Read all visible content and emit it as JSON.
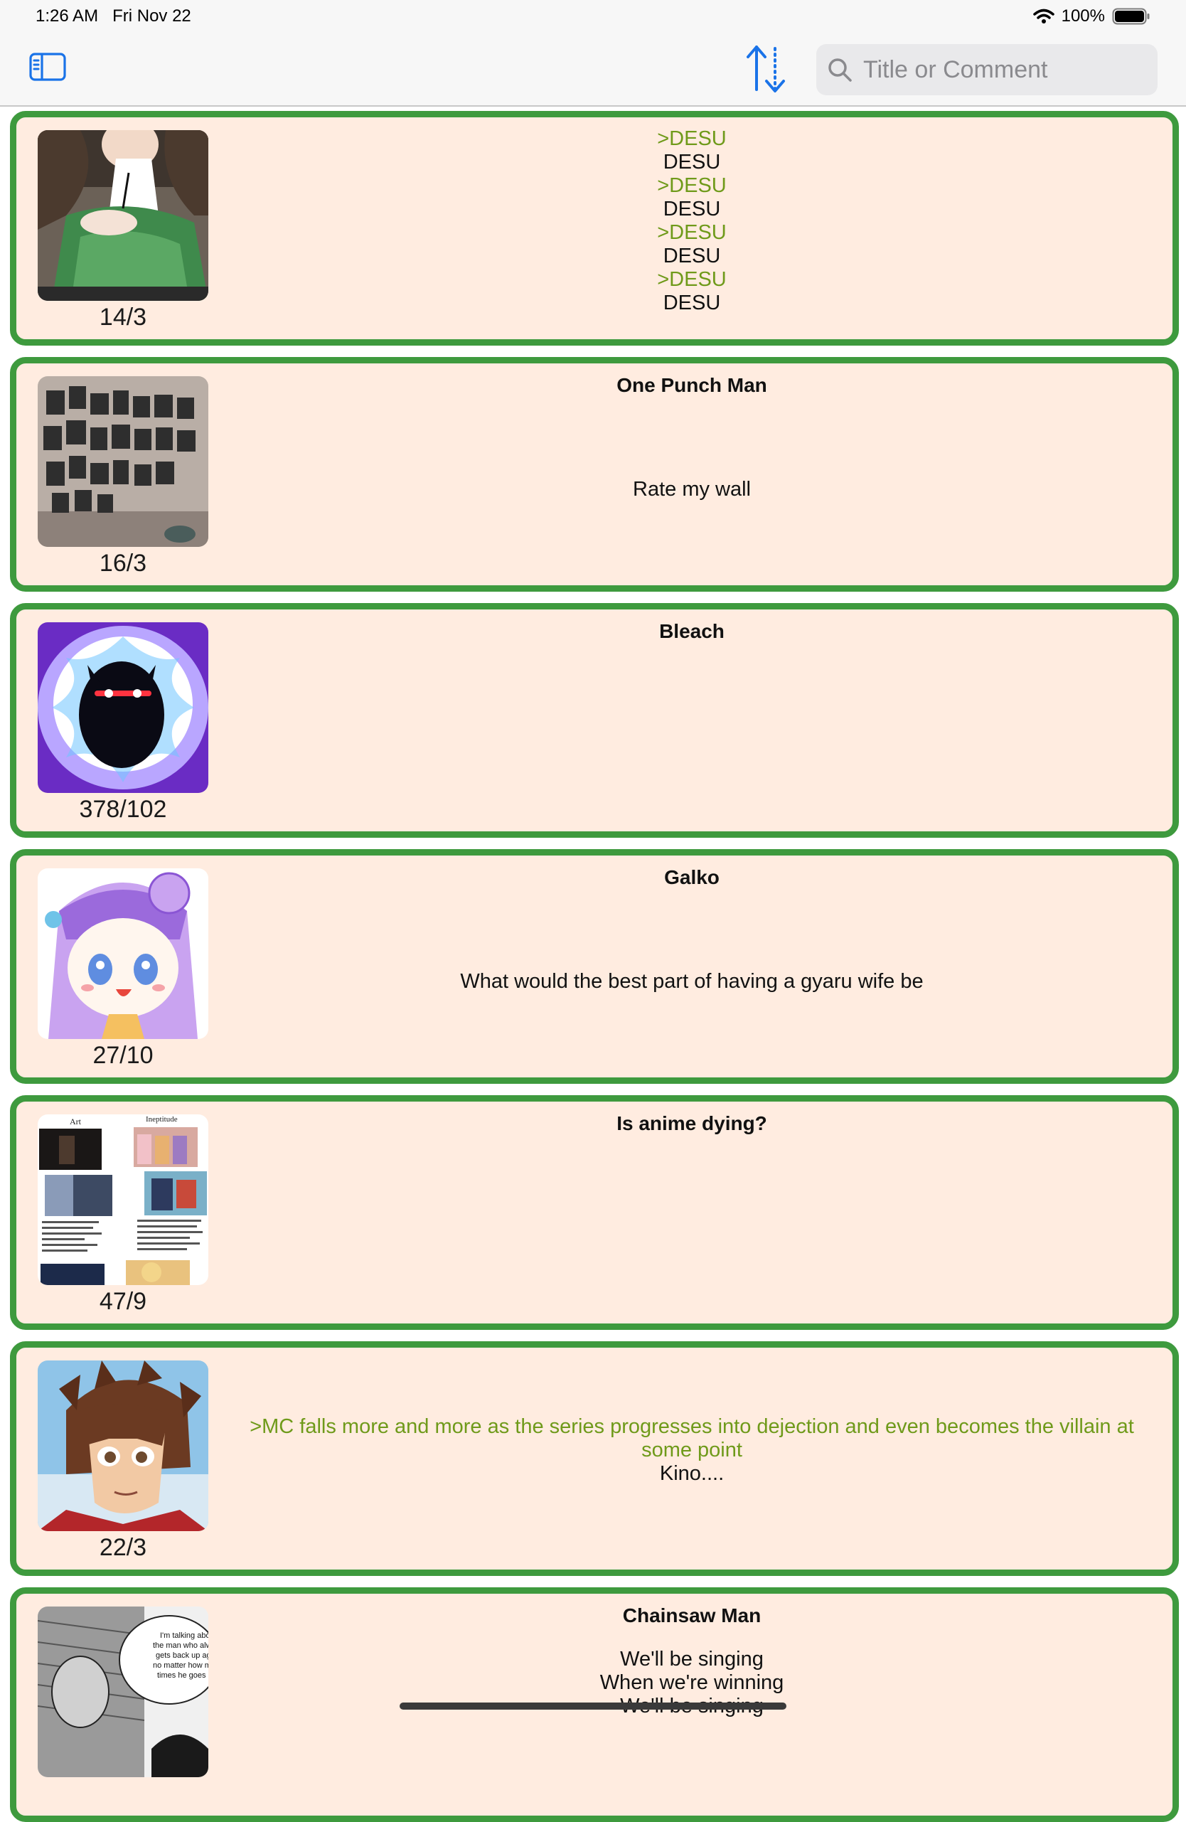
{
  "status": {
    "time": "1:26 AM",
    "date": "Fri Nov 22",
    "battery": "100%"
  },
  "search": {
    "placeholder": "Title or Comment",
    "value": ""
  },
  "colors": {
    "card_border": "#3e9a3e",
    "card_bg": "#ffece0",
    "quote": "#6f9a1a",
    "accent": "#1a73e8"
  },
  "threads": [
    {
      "counts": "14/3",
      "title": "",
      "lines": [
        ">DESU",
        "DESU",
        ">DESU",
        "DESU",
        ">DESU",
        "DESU",
        ">DESU",
        "DESU"
      ]
    },
    {
      "counts": "16/3",
      "title": "One Punch Man",
      "lines": [
        "Rate my wall"
      ]
    },
    {
      "counts": "378/102",
      "title": "Bleach",
      "lines": []
    },
    {
      "counts": "27/10",
      "title": "Galko",
      "lines": [
        "What would the best part of having a gyaru wife be"
      ]
    },
    {
      "counts": "47/9",
      "title": "Is anime dying?",
      "lines": []
    },
    {
      "counts": "22/3",
      "title": "",
      "lines": [
        ">MC falls more and more as the series progresses into dejection and even becomes the villain at some point",
        "Kino...."
      ]
    },
    {
      "counts": "",
      "title": "Chainsaw Man",
      "lines": [
        "We'll be singing",
        "When we're winning",
        "We'll be singing"
      ]
    }
  ],
  "thumbnails": {
    "t1": {
      "label": ""
    },
    "t5": {
      "left": "Art",
      "right": "Ineptitude"
    },
    "t7": {
      "bubble": [
        "I'm talking abo",
        "the man who alw",
        "gets back up ag",
        "no matter how m",
        "times he goes do"
      ]
    }
  }
}
